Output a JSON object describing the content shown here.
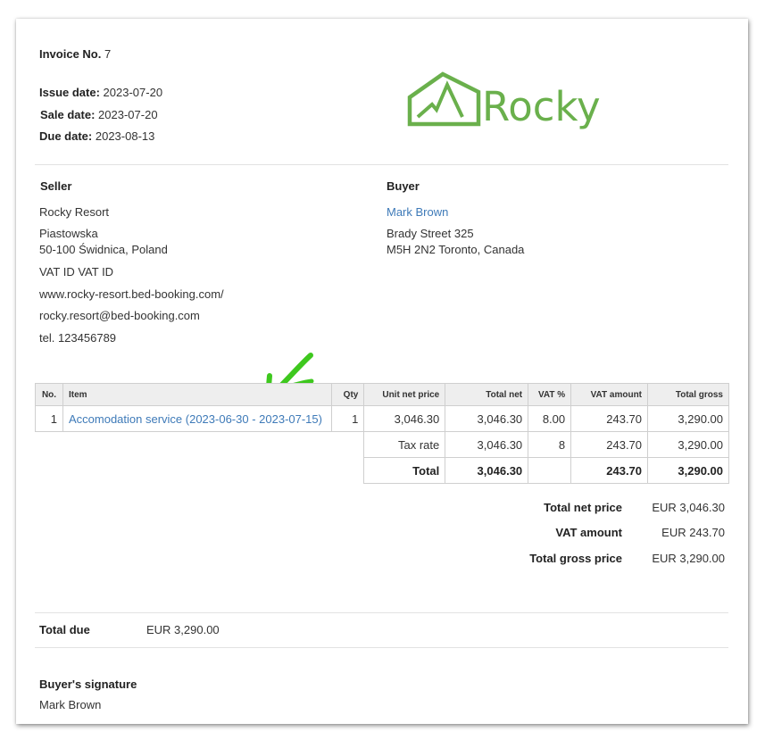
{
  "invoice": {
    "number_label": "Invoice No.",
    "number": "7",
    "issue_label": "Issue date:",
    "issue_date": "2023-07-20",
    "sale_label": "Sale date:",
    "sale_date": "2023-07-20",
    "due_label": "Due date:",
    "due_date": "2023-08-13"
  },
  "logo": {
    "text": "Rocky",
    "color": "#6ab04c"
  },
  "seller": {
    "heading": "Seller",
    "name": "Rocky Resort",
    "street": "Piastowska",
    "city": "50-100 Świdnica, Poland",
    "vat": "VAT ID VAT ID",
    "website": "www.rocky-resort.bed-booking.com/",
    "email": "rocky.resort@bed-booking.com",
    "phone": "tel. 123456789"
  },
  "buyer": {
    "heading": "Buyer",
    "name": "Mark Brown",
    "street": "Brady Street 325",
    "city": "M5H 2N2 Toronto, Canada"
  },
  "table": {
    "headers": [
      "No.",
      "Item",
      "Qty",
      "Unit net price",
      "Total net",
      "VAT %",
      "VAT amount",
      "Total gross"
    ],
    "rows": [
      {
        "no": "1",
        "item": "Accomodation service (2023-06-30 - 2023-07-15)",
        "qty": "1",
        "unit_net": "3,046.30",
        "total_net": "3,046.30",
        "vat_pct": "8.00",
        "vat_amount": "243.70",
        "total_gross": "3,290.00"
      }
    ],
    "tax_rate": {
      "label": "Tax rate",
      "total_net": "3,046.30",
      "vat_pct": "8",
      "vat_amount": "243.70",
      "total_gross": "3,290.00"
    },
    "total": {
      "label": "Total",
      "total_net": "3,046.30",
      "vat_amount": "243.70",
      "total_gross": "3,290.00"
    }
  },
  "summary": {
    "net_label": "Total net price",
    "net_value": "EUR 3,046.30",
    "vat_label": "VAT amount",
    "vat_value": "EUR 243.70",
    "gross_label": "Total gross price",
    "gross_value": "EUR 3,290.00"
  },
  "due": {
    "label": "Total due",
    "value": "EUR 3,290.00"
  },
  "signature": {
    "label": "Buyer's signature",
    "name": "Mark Brown"
  },
  "colors": {
    "link": "#3e7ab8",
    "arrow": "#3ec81e",
    "header_bg": "#eeeeee"
  }
}
